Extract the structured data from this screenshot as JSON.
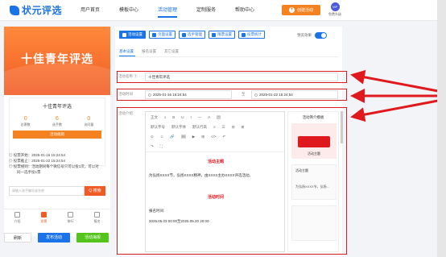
{
  "header": {
    "logo_text": "状元评选",
    "nav": [
      "用户首页",
      "模板中心",
      "活动管理",
      "定制服务",
      "帮助中心"
    ],
    "nav_active_index": 2,
    "create_label": "创建活动",
    "upgrade_label": "免费升级",
    "avatar_text": "VIP"
  },
  "preview": {
    "poster_title": "十佳青年评选",
    "card_name": "十佳青年评选",
    "stats": [
      {
        "value": "0",
        "label": "总票数"
      },
      {
        "value": "6",
        "label": "选手数"
      },
      {
        "value": "0",
        "label": "访问量"
      }
    ],
    "rule_button": "活动规则",
    "meta": [
      "◎ 投票开始：2025-01-16 15:24:54",
      "◎ 投票截止：2025-01-22 15:24:54",
      "◎ 投票规则：活动期间每个微信号只可以投1次，可以对",
      "同一选手投1票"
    ],
    "search_placeholder": "请输入选手编号或名称",
    "search_button": "Q 搜索",
    "tabs": [
      "介绍",
      "投票",
      "排行",
      "报名"
    ],
    "tab_active_index": 1
  },
  "bottom_buttons": {
    "refresh": "刷新",
    "publish": "发布活动",
    "poster": "活动海报"
  },
  "editor": {
    "toolbar": [
      {
        "label": "活动设置",
        "icon": "gear-icon"
      },
      {
        "label": "页面设置",
        "icon": "gear-icon"
      },
      {
        "label": "选手管理",
        "icon": "users-icon"
      },
      {
        "label": "限票设置",
        "icon": "ticket-icon"
      },
      {
        "label": "投票统计",
        "icon": "chart-icon"
      }
    ],
    "preview_toggle_label": "预览效果",
    "subtabs": [
      "基本设置",
      "报名设置",
      "其它设置"
    ],
    "name_label": "活动名称 ⑦",
    "name_value": "十佳青年评选",
    "time_label": "活动时间",
    "time_start": "2025-01-16 15:24:54",
    "time_sep": "至",
    "time_end": "2025-01-22 15:24:54",
    "intro_label": "活动介绍",
    "rte_tools_row1": [
      "正文",
      "ↄ",
      "B",
      "U",
      "I",
      "—",
      "A",
      "囲"
    ],
    "rte_tools_row2": [
      "默认字号",
      "默认字体",
      "默认行高",
      "≡",
      "☰",
      "⊟",
      "⊞"
    ],
    "rte_tools_row3": [
      "⊙",
      "☺",
      "🔗",
      "🖼",
      "▶",
      "⊞",
      "</>",
      "↶"
    ],
    "rte_tools_row4": [
      "↷",
      "⛶"
    ],
    "content_heading1": "活动主题",
    "content_para1": "为弘扬XXXX节，弘扬XXXX精神，由XXXX主办XXXX评选活动。",
    "content_heading2": "活动时间",
    "content_para2": "报名时间:",
    "content_para3": "2025.05.03 00:00至2025.05.20 20:00",
    "template_title": "活动简介模板",
    "template_card2_title": "活动主题",
    "template_card2_text": "为弘扬XXXX节，弘扬...",
    "template_card1_text": "活动主题"
  }
}
